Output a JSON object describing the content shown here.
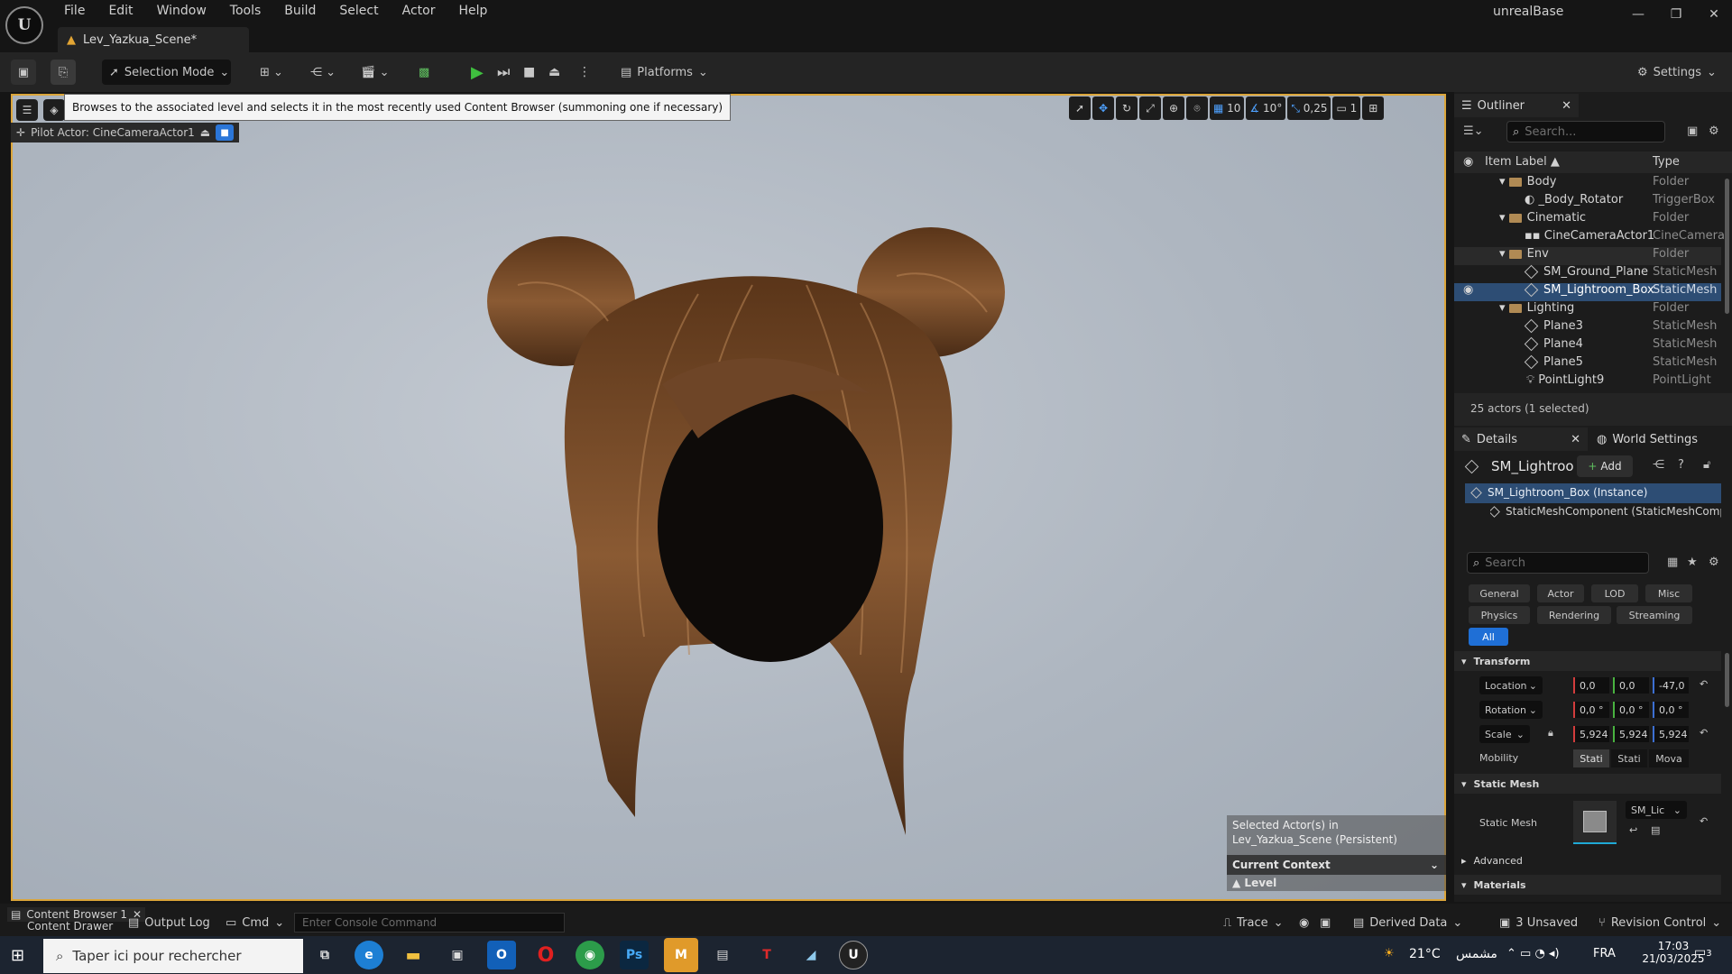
{
  "app": {
    "menus": [
      "File",
      "Edit",
      "Window",
      "Tools",
      "Build",
      "Select",
      "Actor",
      "Help"
    ],
    "project_name": "unrealBase",
    "level_tab": "Lev_Yazkua_Scene*"
  },
  "toolbar": {
    "selection_mode": "Selection Mode",
    "platforms": "Platforms",
    "settings": "Settings"
  },
  "viewport": {
    "tooltip": "Browses to the associated level and selects it in the most recently used Content Browser (summoning one if necessary)",
    "pilot_actor": "Pilot Actor: CineCameraActor1",
    "grid_snap": "10",
    "rotation_snap": "10°",
    "scale_snap": "0,25",
    "camera_speed": "1",
    "selected_info": "Selected Actor(s) in Lev_Yazkua_Scene (Persistent)",
    "current_context": "Current Context",
    "level_label": "Level",
    "level_value": "Lev_Yazkua_Scene (Persistent)"
  },
  "outliner": {
    "title": "Outliner",
    "search_placeholder": "Search...",
    "col_label": "Item Label ▲",
    "col_type": "Type",
    "rows": [
      {
        "name": "Body",
        "type": "Folder"
      },
      {
        "name": "_Body_Rotator",
        "type": "TriggerBox"
      },
      {
        "name": "Cinematic",
        "type": "Folder"
      },
      {
        "name": "CineCameraActor1",
        "type": "CineCamera"
      },
      {
        "name": "Env",
        "type": "Folder"
      },
      {
        "name": "SM_Ground_Plane",
        "type": "StaticMesh"
      },
      {
        "name": "SM_Lightroom_Box",
        "type": "StaticMesh"
      },
      {
        "name": "Lighting",
        "type": "Folder"
      },
      {
        "name": "Plane3",
        "type": "StaticMesh"
      },
      {
        "name": "Plane4",
        "type": "StaticMesh"
      },
      {
        "name": "Plane5",
        "type": "StaticMesh"
      },
      {
        "name": "PointLight9",
        "type": "PointLight"
      }
    ],
    "status": "25 actors (1 selected)"
  },
  "details": {
    "title": "Details",
    "world_settings": "World Settings",
    "actor_name": "SM_Lightroo",
    "add_label": "Add",
    "instance": "SM_Lightroom_Box (Instance)",
    "component": "StaticMeshComponent (StaticMeshComp",
    "search_placeholder": "Search",
    "filters": [
      "General",
      "Actor",
      "LOD",
      "Misc",
      "Physics",
      "Rendering",
      "Streaming",
      "All"
    ],
    "transform_title": "Transform",
    "location_label": "Location",
    "location": [
      "0,0",
      "0,0",
      "-47,0"
    ],
    "rotation_label": "Rotation",
    "rotation": [
      "0,0 °",
      "0,0 °",
      "0,0 °"
    ],
    "scale_label": "Scale",
    "scale": [
      "5,924",
      "5,924",
      "5,924"
    ],
    "mobility_label": "Mobility",
    "mobility": [
      "Stati",
      "Stati",
      "Mova"
    ],
    "static_mesh_title": "Static Mesh",
    "static_mesh_label": "Static Mesh",
    "static_mesh_value": "SM_Lic",
    "advanced": "Advanced",
    "materials": "Materials"
  },
  "bottom": {
    "content_browser": "Content Browser 1",
    "content_drawer": "Content Drawer",
    "output_log": "Output Log",
    "cmd": "Cmd",
    "console_placeholder": "Enter Console Command",
    "trace": "Trace",
    "derived_data": "Derived Data",
    "unsaved": "3 Unsaved",
    "revision_control": "Revision Control"
  },
  "taskbar": {
    "search_placeholder": "Taper ici pour rechercher",
    "weather": "21°C",
    "weather_desc": "مشمس",
    "lang": "FRA",
    "time": "17:03",
    "date": "21/03/2025",
    "notif_count": "3"
  }
}
